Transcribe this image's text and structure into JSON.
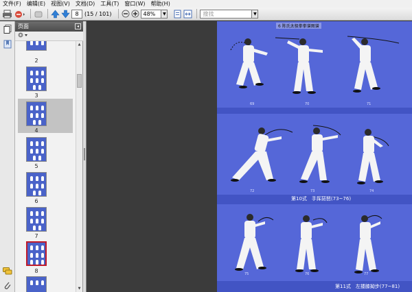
{
  "menu": [
    {
      "label": "文件(F)"
    },
    {
      "label": "编辑(E)"
    },
    {
      "label": "视图(V)"
    },
    {
      "label": "文档(D)"
    },
    {
      "label": "工具(T)"
    },
    {
      "label": "窗口(W)"
    },
    {
      "label": "帮助(H)"
    }
  ],
  "toolbar": {
    "page_value": "8",
    "page_count": "(15 / 101)",
    "zoom_value": "48%",
    "search_placeholder": "搜找"
  },
  "panel": {
    "title": "页面"
  },
  "thumbnails": [
    {
      "label": "2"
    },
    {
      "label": "3"
    },
    {
      "label": "4"
    },
    {
      "label": "5"
    },
    {
      "label": "6"
    },
    {
      "label": "7"
    },
    {
      "label": "8"
    }
  ],
  "page": {
    "header": "6 陈氏太极拳拳谱图谱",
    "caption_1": "第10式　手挥琵琶(73~76)",
    "caption_2": "第11式　左搂膝拗步(77~81)",
    "figure_numbers": [
      "69",
      "70",
      "71",
      "72",
      "73",
      "74",
      "75",
      "76",
      "77"
    ]
  },
  "colors": {
    "page_blue": "#5567d8",
    "band_blue": "#4254c4",
    "selected_outline": "#c01a2a"
  }
}
